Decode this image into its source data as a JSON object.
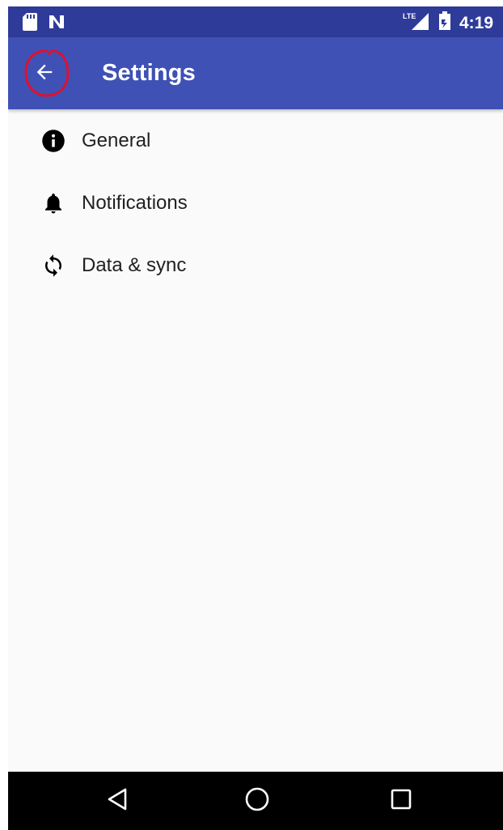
{
  "status_bar": {
    "time": "4:19",
    "icons": [
      "sd-card-icon",
      "notification-n-icon",
      "lte-signal-icon",
      "battery-icon"
    ],
    "network_label": "LTE"
  },
  "app_bar": {
    "title": "Settings",
    "back_icon": "arrow-back-icon",
    "color": "#3f51b5",
    "annotation_color": "#e0102e"
  },
  "settings": {
    "items": [
      {
        "label": "General",
        "icon": "info-icon"
      },
      {
        "label": "Notifications",
        "icon": "bell-icon"
      },
      {
        "label": "Data & sync",
        "icon": "sync-icon"
      }
    ]
  },
  "nav_bar": {
    "buttons": [
      "back-triangle-icon",
      "home-circle-icon",
      "recents-square-icon"
    ]
  }
}
